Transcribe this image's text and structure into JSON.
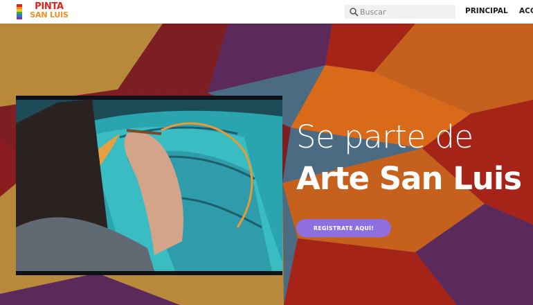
{
  "header": {
    "logo": {
      "line1": "PINTA",
      "line2": "SAN LUIS"
    },
    "search": {
      "placeholder": "Buscar",
      "value": ""
    },
    "nav": [
      "PRINCIPAL",
      "ACC"
    ]
  },
  "hero": {
    "headline_line1": "Se parte de",
    "headline_line2": "Arte San Luis",
    "cta_label": "REGÍSTRATE AQUÍ!"
  },
  "colors": {
    "header_bg": "#ffffff",
    "cta": "#8f6fe0",
    "logo_red": "#e2231a",
    "logo_orange": "#f28c1e",
    "hero_text": "#ffffff"
  }
}
